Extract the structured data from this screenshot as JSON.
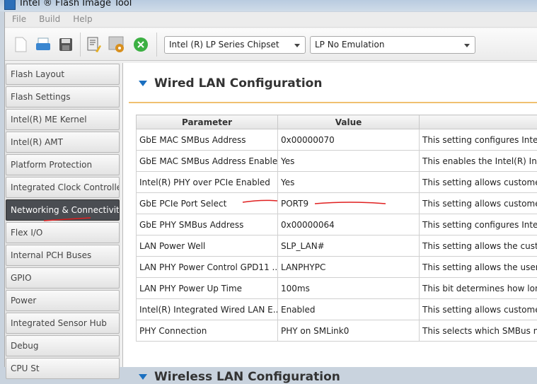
{
  "window": {
    "title": "Intel ® Flash Image Tool"
  },
  "menu": [
    "File",
    "Build",
    "Help"
  ],
  "toolbar": {
    "icons": [
      "new-file-icon",
      "open-icon",
      "save-icon",
      "edit-clean-icon",
      "settings-icon",
      "build-icon"
    ],
    "chipset": "Intel (R) LP Series Chipset",
    "emulation": "LP No Emulation"
  },
  "sidebar": {
    "items": [
      "Flash Layout",
      "Flash Settings",
      "Intel(R) ME Kernel",
      "Intel(R) AMT",
      "Platform Protection",
      "Integrated Clock Controller",
      "Networking & Connectivity",
      "Flex I/O",
      "Internal PCH Buses",
      "GPIO",
      "Power",
      "Integrated Sensor Hub",
      "Debug",
      "CPU St"
    ],
    "active": "Networking & Connectivity"
  },
  "main": {
    "section_title": "Wired LAN Configuration",
    "next_section_title": "Wireless LAN Configuration",
    "columns": [
      "Parameter",
      "Value",
      ""
    ],
    "rows": [
      [
        "GbE MAC SMBus Address",
        "0x00000070",
        "This setting configures Intel(R"
      ],
      [
        "GbE MAC SMBus Address Enabled",
        "Yes",
        "This enables the Intel(R) Inte"
      ],
      [
        "Intel(R) PHY over PCIe Enabled",
        "Yes",
        "This setting allows customers"
      ],
      [
        "GbE PCIe Port Select",
        "PORT9",
        "This setting allows customers"
      ],
      [
        "GbE PHY SMBus Address",
        "0x00000064",
        "This setting configures Intel(R"
      ],
      [
        "LAN Power Well",
        "SLP_LAN#",
        "This setting allows the custom"
      ],
      [
        "LAN PHY Power Control GPD11 ...",
        "LANPHYPC",
        "This setting allows the user to"
      ],
      [
        "LAN PHY Power Up Time",
        "100ms",
        "This bit determines how long"
      ],
      [
        "Intel(R) Integrated Wired LAN E...",
        "Enabled",
        "This setting allows customers"
      ],
      [
        "PHY Connection",
        "PHY on SMLink0",
        "This selects which SMBus net"
      ]
    ]
  },
  "colors": {
    "accent": "#1a6fc0",
    "annotation": "#e02020",
    "active_item": "#4a4d52"
  }
}
